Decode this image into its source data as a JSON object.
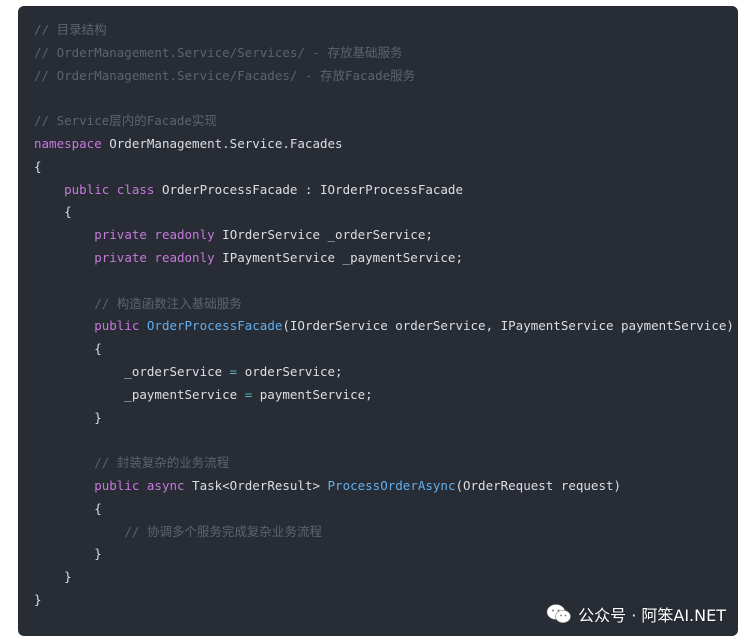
{
  "colors": {
    "background": "#282c34",
    "comment": "#5c6370",
    "keyword": "#c678dd",
    "function": "#61afef",
    "operator": "#56b6c2",
    "text": "#dcdfe4"
  },
  "code": {
    "language": "csharp",
    "lines": [
      [
        {
          "t": "c-comment",
          "v": "// 目录结构"
        }
      ],
      [
        {
          "t": "c-comment",
          "v": "// OrderManagement.Service/Services/ - 存放基础服务"
        }
      ],
      [
        {
          "t": "c-comment",
          "v": "// OrderManagement.Service/Facades/ - 存放Facade服务"
        }
      ],
      [],
      [
        {
          "t": "c-comment",
          "v": "// Service层内的Facade实现"
        }
      ],
      [
        {
          "t": "c-keyword",
          "v": "namespace"
        },
        {
          "t": "c-plain",
          "v": " OrderManagement.Service.Facades"
        }
      ],
      [
        {
          "t": "c-plain",
          "v": "{"
        }
      ],
      [
        {
          "t": "c-plain",
          "v": "    "
        },
        {
          "t": "c-keyword",
          "v": "public class"
        },
        {
          "t": "c-plain",
          "v": " OrderProcessFacade : IOrderProcessFacade"
        }
      ],
      [
        {
          "t": "c-plain",
          "v": "    {"
        }
      ],
      [
        {
          "t": "c-plain",
          "v": "        "
        },
        {
          "t": "c-keyword",
          "v": "private readonly"
        },
        {
          "t": "c-plain",
          "v": " IOrderService _orderService;"
        }
      ],
      [
        {
          "t": "c-plain",
          "v": "        "
        },
        {
          "t": "c-keyword",
          "v": "private readonly"
        },
        {
          "t": "c-plain",
          "v": " IPaymentService _paymentService;"
        }
      ],
      [],
      [
        {
          "t": "c-plain",
          "v": "        "
        },
        {
          "t": "c-comment",
          "v": "// 构造函数注入基础服务"
        }
      ],
      [
        {
          "t": "c-plain",
          "v": "        "
        },
        {
          "t": "c-keyword",
          "v": "public"
        },
        {
          "t": "c-plain",
          "v": " "
        },
        {
          "t": "c-func",
          "v": "OrderProcessFacade"
        },
        {
          "t": "c-plain",
          "v": "(IOrderService orderService, IPaymentService paymentService)"
        }
      ],
      [
        {
          "t": "c-plain",
          "v": "        {"
        }
      ],
      [
        {
          "t": "c-plain",
          "v": "            _orderService "
        },
        {
          "t": "c-op",
          "v": "="
        },
        {
          "t": "c-plain",
          "v": " orderService;"
        }
      ],
      [
        {
          "t": "c-plain",
          "v": "            _paymentService "
        },
        {
          "t": "c-op",
          "v": "="
        },
        {
          "t": "c-plain",
          "v": " paymentService;"
        }
      ],
      [
        {
          "t": "c-plain",
          "v": "        }"
        }
      ],
      [],
      [
        {
          "t": "c-plain",
          "v": "        "
        },
        {
          "t": "c-comment",
          "v": "// 封装复杂的业务流程"
        }
      ],
      [
        {
          "t": "c-plain",
          "v": "        "
        },
        {
          "t": "c-keyword",
          "v": "public async"
        },
        {
          "t": "c-plain",
          "v": " Task<OrderResult> "
        },
        {
          "t": "c-func",
          "v": "ProcessOrderAsync"
        },
        {
          "t": "c-plain",
          "v": "(OrderRequest request)"
        }
      ],
      [
        {
          "t": "c-plain",
          "v": "        {"
        }
      ],
      [
        {
          "t": "c-plain",
          "v": "            "
        },
        {
          "t": "c-comment",
          "v": "// 协调多个服务完成复杂业务流程"
        }
      ],
      [
        {
          "t": "c-plain",
          "v": "        }"
        }
      ],
      [
        {
          "t": "c-plain",
          "v": "    }"
        }
      ],
      [
        {
          "t": "c-plain",
          "v": "}"
        }
      ]
    ]
  },
  "watermark": {
    "icon": "wechat-icon",
    "text": "公众号 · 阿笨AI.NET"
  }
}
